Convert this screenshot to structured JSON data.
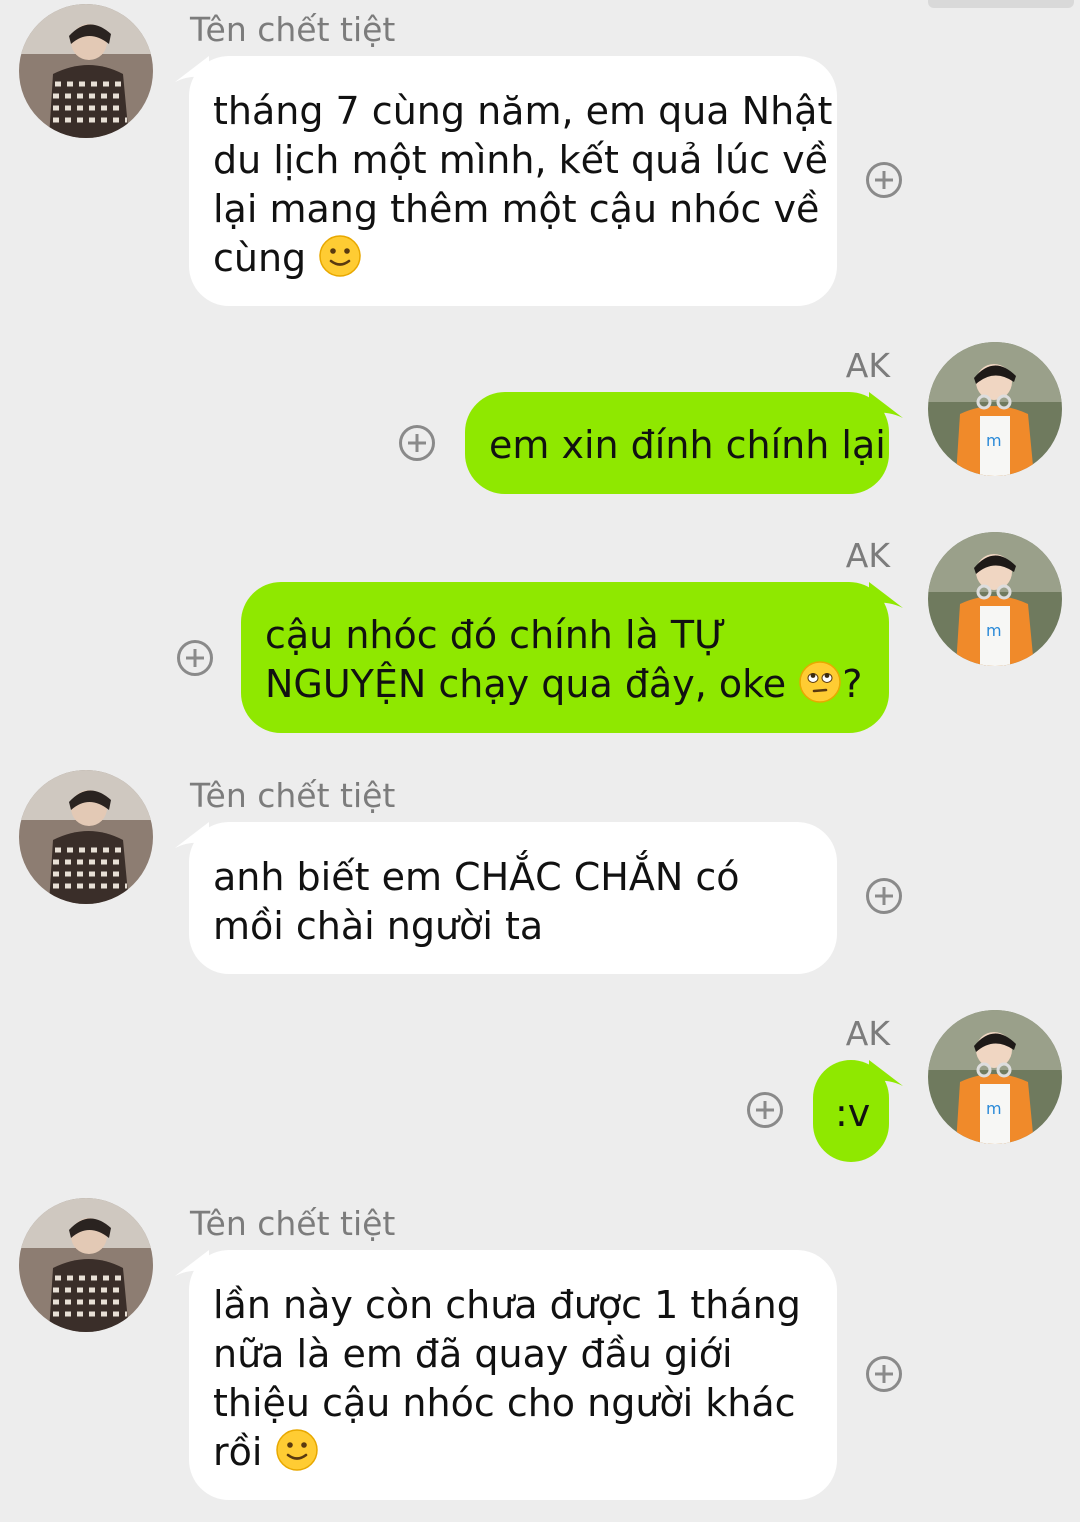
{
  "chat": {
    "messages": [
      {
        "direction": "incoming",
        "sender": "Tên chết tiệt",
        "lines": [
          "tháng 7 cùng năm, em qua Nhật",
          "du lịch một mình, kết quả lúc về",
          "lại mang thêm một cậu nhóc về",
          "cùng "
        ],
        "trailing_emoji": "slightly-smiling-face-icon"
      },
      {
        "direction": "outgoing",
        "sender": "AK",
        "lines": [
          "em xin đính chính lại"
        ]
      },
      {
        "direction": "outgoing",
        "sender": "AK",
        "lines": [
          "cậu nhóc đó chính là TỰ",
          "NGUYỆN chạy qua đây, oke "
        ],
        "inline_emoji": "face-with-rolling-eyes-icon",
        "after_emoji": "?"
      },
      {
        "direction": "incoming",
        "sender": "Tên chết tiệt",
        "lines": [
          "anh biết em CHẮC CHẮN có",
          "mồi chài người ta"
        ]
      },
      {
        "direction": "outgoing",
        "sender": "AK",
        "lines": [
          ":v"
        ]
      },
      {
        "direction": "incoming",
        "sender": "Tên chết tiệt",
        "lines": [
          "lần này còn chưa được 1 tháng",
          "nữa là em đã quay đầu giới",
          "thiệu cậu nhóc cho người khác",
          "rồi "
        ],
        "trailing_emoji": "slightly-smiling-face-icon"
      }
    ]
  },
  "colors": {
    "background": "#ededed",
    "incoming_bubble": "#ffffff",
    "outgoing_bubble": "#8fe800",
    "sender_name": "#7c7c7c",
    "add_icon": "#8a8a8a"
  }
}
